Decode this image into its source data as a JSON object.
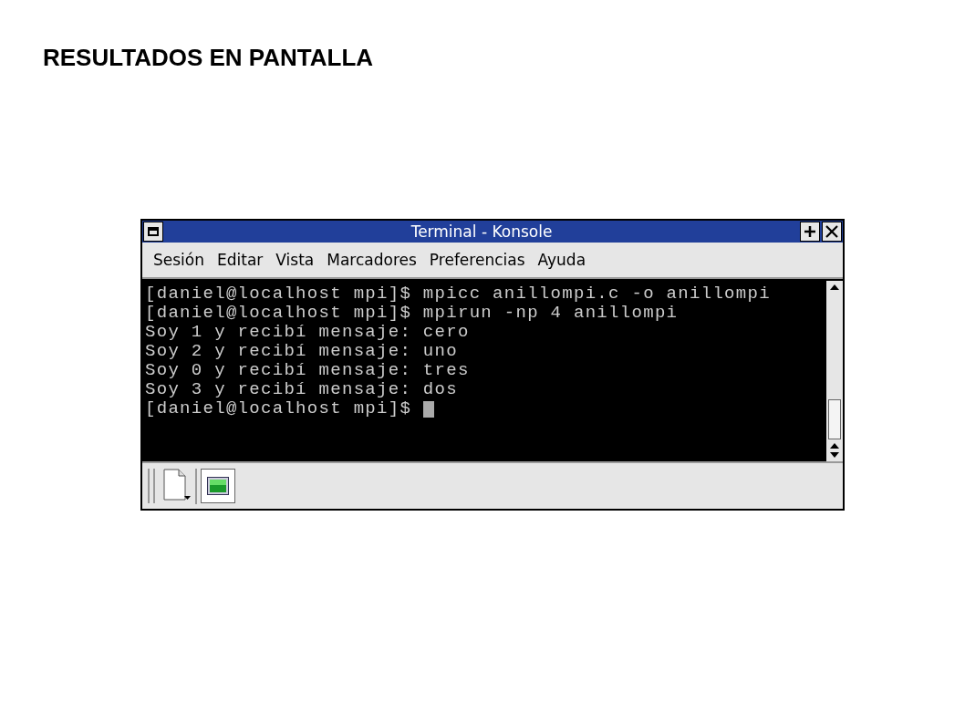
{
  "slide_title": "RESULTADOS EN PANTALLA",
  "window": {
    "title": "Terminal - Konsole"
  },
  "menu": [
    "Sesión",
    "Editar",
    "Vista",
    "Marcadores",
    "Preferencias",
    "Ayuda"
  ],
  "terminal": {
    "lines": [
      "[daniel@localhost mpi]$ mpicc anillompi.c -o anillompi",
      "[daniel@localhost mpi]$ mpirun -np 4 anillompi",
      "Soy 1 y recibí mensaje: cero",
      "Soy 2 y recibí mensaje: uno",
      "Soy 0 y recibí mensaje: tres",
      "Soy 3 y recibí mensaje: dos",
      "[daniel@localhost mpi]$ "
    ],
    "cursor": true
  },
  "sessions": [
    {
      "selected": true
    }
  ]
}
